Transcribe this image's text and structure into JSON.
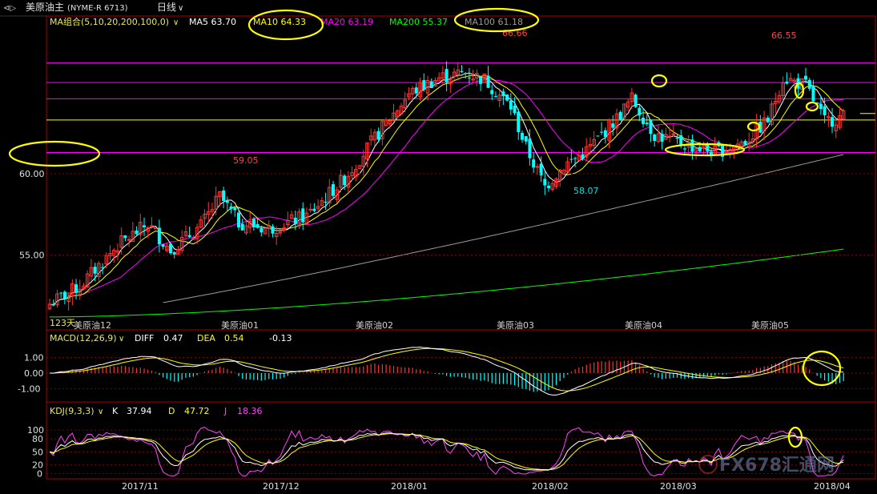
{
  "header": {
    "symbol": "美原油主",
    "code": "(NYME-R 6713)",
    "period": "日线"
  },
  "ma_legend": {
    "label": "MA组合(5,10,20,200,100,0)",
    "items": [
      {
        "text": "MA5 63.70",
        "color": "#ffffff"
      },
      {
        "text": "MA10 64.33",
        "color": "#ffff00"
      },
      {
        "text": "MA20 63.19",
        "color": "#ff00ff"
      },
      {
        "text": "MA200 55.37",
        "color": "#00ff00"
      },
      {
        "text": "MA100 61.18",
        "color": "#9a9a9a"
      }
    ]
  },
  "colors": {
    "up": "#ff3333",
    "down": "#00ffff",
    "ma5": "#ffffff",
    "ma10": "#ffff00",
    "ma20": "#ff00ff",
    "ma100": "#9a9a9a",
    "ma200": "#00ff00",
    "grid": "#8b0000",
    "annotation": "#ffff00",
    "pane_border": "#aa0000"
  },
  "chart_data": [
    {
      "type": "candlestick",
      "price_labels": [
        "60.00",
        "55.00"
      ],
      "price_ticks": [
        60,
        55
      ],
      "ylim": [
        51.0,
        68.8
      ],
      "markers": [
        {
          "label": "66.66",
          "value": 66.66,
          "kind": "high"
        },
        {
          "label": "59.05",
          "value": 59.05,
          "kind": "high"
        },
        {
          "label": "66.55",
          "value": 66.55,
          "kind": "high"
        },
        {
          "label": "58.07",
          "value": 58.07,
          "kind": "low"
        }
      ],
      "horizontal_lines": [
        {
          "value": 66.8,
          "color": "#ff00ff"
        },
        {
          "value": 65.6,
          "color": "#ff00ff"
        },
        {
          "value": 64.6,
          "color": "#ff00ff"
        },
        {
          "value": 63.3,
          "color": "#ffff00"
        },
        {
          "value": 61.3,
          "color": "#ff00ff"
        }
      ],
      "contract_labels": [
        "美原油12",
        "美原油01",
        "美原油02",
        "美原油03",
        "美原油04",
        "美原油05"
      ],
      "bar_count_label": "123天",
      "ma200": {
        "start": 51.2,
        "end": 55.37
      },
      "ma100": {
        "start": 51.0,
        "end": 61.18
      }
    },
    {
      "type": "macd",
      "label": "MACD(12,26,9)",
      "diff_label": "DIFF",
      "diff_value": "0.47",
      "dea_label": "DEA",
      "dea_value": "0.54",
      "macd_value": "-0.13",
      "ticks": [
        "1.00",
        "0.00",
        "-1.00"
      ],
      "tick_values": [
        1,
        0,
        -1
      ],
      "ylim": [
        -1.75,
        1.75
      ]
    },
    {
      "type": "kdj",
      "label": "KDJ(9,3,3)",
      "k_label": "K",
      "k_value": "37.94",
      "d_label": "D",
      "d_value": "47.72",
      "j_label": "J",
      "j_value": "18.36",
      "ticks": [
        "100",
        "80",
        "50",
        "20",
        "0"
      ],
      "tick_values": [
        100,
        80,
        50,
        20,
        0
      ],
      "ylim": [
        -10,
        128
      ]
    }
  ],
  "time_axis": [
    "2017/11",
    "2017/12",
    "2018/01",
    "2018/02",
    "2018/03",
    "2018/04"
  ],
  "watermark": "FX678汇通网"
}
